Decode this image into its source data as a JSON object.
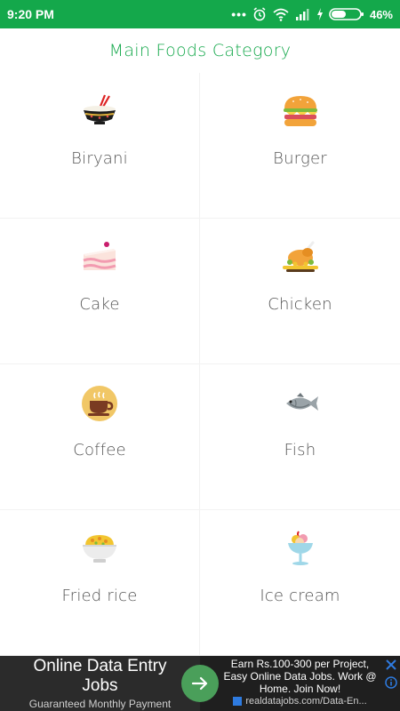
{
  "status_bar": {
    "time": "9:20 PM",
    "battery": "46%",
    "icons": [
      "more-dots-icon",
      "alarm-icon",
      "wifi-icon",
      "signal-icon",
      "charging-icon",
      "battery-icon"
    ]
  },
  "header": {
    "title": "Main Foods Category"
  },
  "categories": [
    {
      "label": "Biryani",
      "icon": "rice-bowl-chopsticks-icon"
    },
    {
      "label": "Burger",
      "icon": "burger-icon"
    },
    {
      "label": "Cake",
      "icon": "cake-slice-icon"
    },
    {
      "label": "Chicken",
      "icon": "roast-chicken-icon"
    },
    {
      "label": "Coffee",
      "icon": "coffee-cup-icon"
    },
    {
      "label": "Fish",
      "icon": "fish-icon"
    },
    {
      "label": "Fried rice",
      "icon": "fried-rice-bowl-icon"
    },
    {
      "label": "Ice cream",
      "icon": "ice-cream-cup-icon"
    }
  ],
  "ad": {
    "headline": "Online Data Entry Jobs",
    "subline": "Guaranteed Monthly Payment",
    "description": "Earn Rs.100-300 per Project, Easy Online Data Jobs. Work @ Home. Join Now!",
    "url": "realdatajobs.com/Data-En...",
    "colors": {
      "accent": "#4a9f5a",
      "close": "#2e7be0"
    }
  },
  "colors": {
    "brand_green": "#14a84b",
    "label_gray": "#555555"
  }
}
